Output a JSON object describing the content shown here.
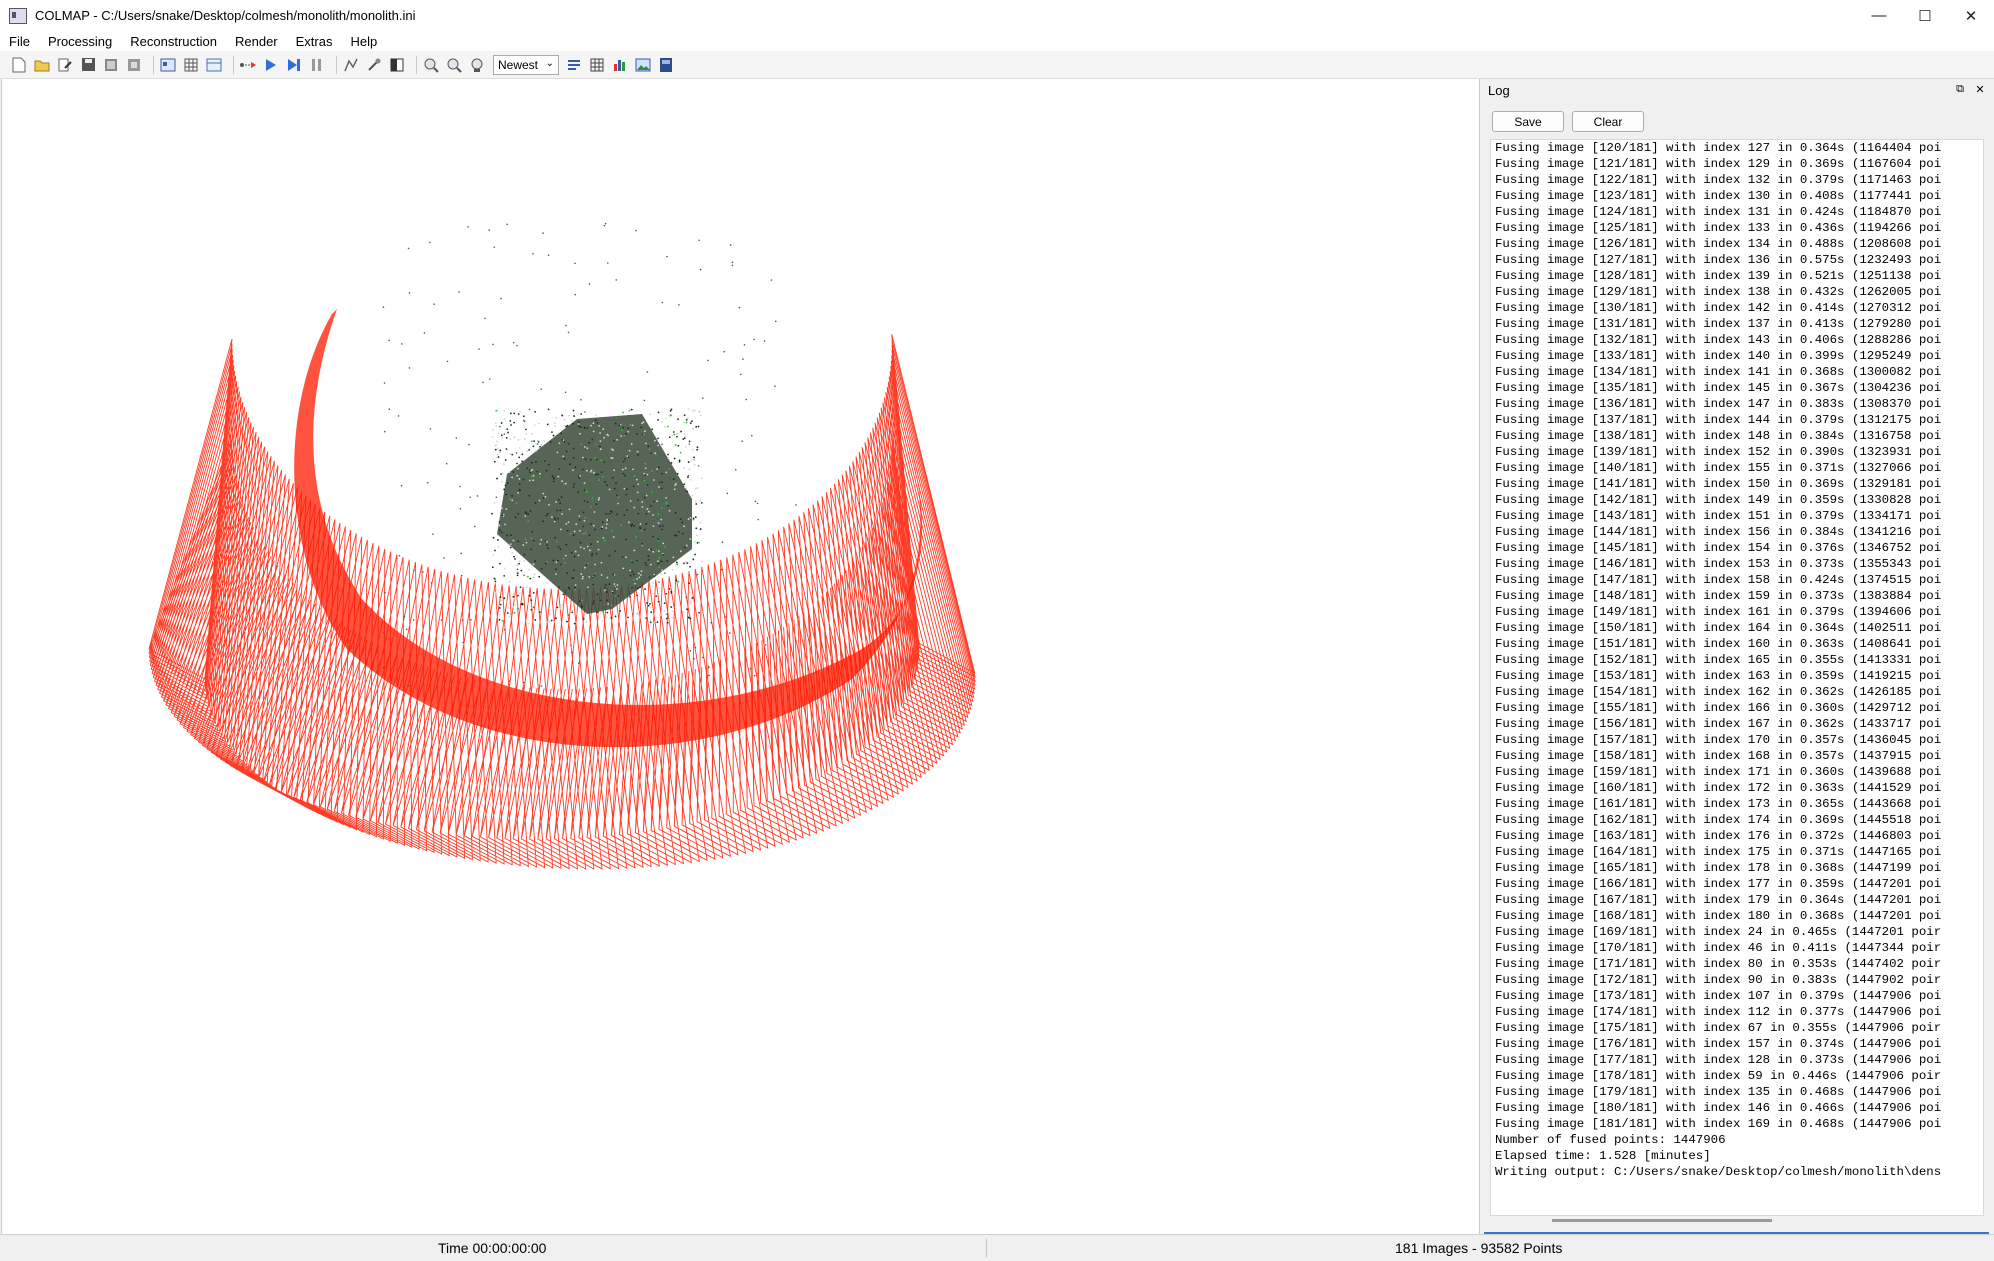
{
  "window": {
    "title": "COLMAP - C:/Users/snake/Desktop/colmesh/monolith/monolith.ini",
    "controls": [
      "—",
      "☐",
      "✕"
    ]
  },
  "menu": [
    "File",
    "Processing",
    "Reconstruction",
    "Render",
    "Extras",
    "Help"
  ],
  "toolbar": {
    "icons": [
      "new-project-icon",
      "open-project-icon",
      "edit-project-icon",
      "save-project-icon",
      "import-icon",
      "export-icon",
      "feature-extraction-icon",
      "feature-matching-icon",
      "database-icon",
      "automatic-reconstruction-icon",
      "start-reconstruction-icon",
      "step-reconstruction-icon",
      "pause-reconstruction-icon",
      "bundle-adjustment-icon",
      "dense-reconstruction-icon",
      "render-options-icon",
      "reconstruction-stats-icon",
      "match-matrix-icon",
      "log-icon"
    ],
    "reconstruction_select": "Newest"
  },
  "log": {
    "title": "Log",
    "save_label": "Save",
    "clear_label": "Clear",
    "lines": [
      "Fusing image [120/181] with index 127 in 0.364s (1164404 poi",
      "Fusing image [121/181] with index 129 in 0.369s (1167604 poi",
      "Fusing image [122/181] with index 132 in 0.379s (1171463 poi",
      "Fusing image [123/181] with index 130 in 0.408s (1177441 poi",
      "Fusing image [124/181] with index 131 in 0.424s (1184870 poi",
      "Fusing image [125/181] with index 133 in 0.436s (1194266 poi",
      "Fusing image [126/181] with index 134 in 0.488s (1208608 poi",
      "Fusing image [127/181] with index 136 in 0.575s (1232493 poi",
      "Fusing image [128/181] with index 139 in 0.521s (1251138 poi",
      "Fusing image [129/181] with index 138 in 0.432s (1262005 poi",
      "Fusing image [130/181] with index 142 in 0.414s (1270312 poi",
      "Fusing image [131/181] with index 137 in 0.413s (1279280 poi",
      "Fusing image [132/181] with index 143 in 0.406s (1288286 poi",
      "Fusing image [133/181] with index 140 in 0.399s (1295249 poi",
      "Fusing image [134/181] with index 141 in 0.368s (1300082 poi",
      "Fusing image [135/181] with index 145 in 0.367s (1304236 poi",
      "Fusing image [136/181] with index 147 in 0.383s (1308370 poi",
      "Fusing image [137/181] with index 144 in 0.379s (1312175 poi",
      "Fusing image [138/181] with index 148 in 0.384s (1316758 poi",
      "Fusing image [139/181] with index 152 in 0.390s (1323931 poi",
      "Fusing image [140/181] with index 155 in 0.371s (1327066 poi",
      "Fusing image [141/181] with index 150 in 0.369s (1329181 poi",
      "Fusing image [142/181] with index 149 in 0.359s (1330828 poi",
      "Fusing image [143/181] with index 151 in 0.379s (1334171 poi",
      "Fusing image [144/181] with index 156 in 0.384s (1341216 poi",
      "Fusing image [145/181] with index 154 in 0.376s (1346752 poi",
      "Fusing image [146/181] with index 153 in 0.373s (1355343 poi",
      "Fusing image [147/181] with index 158 in 0.424s (1374515 poi",
      "Fusing image [148/181] with index 159 in 0.373s (1383884 poi",
      "Fusing image [149/181] with index 161 in 0.379s (1394606 poi",
      "Fusing image [150/181] with index 164 in 0.364s (1402511 poi",
      "Fusing image [151/181] with index 160 in 0.363s (1408641 poi",
      "Fusing image [152/181] with index 165 in 0.355s (1413331 poi",
      "Fusing image [153/181] with index 163 in 0.359s (1419215 poi",
      "Fusing image [154/181] with index 162 in 0.362s (1426185 poi",
      "Fusing image [155/181] with index 166 in 0.360s (1429712 poi",
      "Fusing image [156/181] with index 167 in 0.362s (1433717 poi",
      "Fusing image [157/181] with index 170 in 0.357s (1436045 poi",
      "Fusing image [158/181] with index 168 in 0.357s (1437915 poi",
      "Fusing image [159/181] with index 171 in 0.360s (1439688 poi",
      "Fusing image [160/181] with index 172 in 0.363s (1441529 poi",
      "Fusing image [161/181] with index 173 in 0.365s (1443668 poi",
      "Fusing image [162/181] with index 174 in 0.369s (1445518 poi",
      "Fusing image [163/181] with index 176 in 0.372s (1446803 poi",
      "Fusing image [164/181] with index 175 in 0.371s (1447165 poi",
      "Fusing image [165/181] with index 178 in 0.368s (1447199 poi",
      "Fusing image [166/181] with index 177 in 0.359s (1447201 poi",
      "Fusing image [167/181] with index 179 in 0.364s (1447201 poi",
      "Fusing image [168/181] with index 180 in 0.368s (1447201 poi",
      "Fusing image [169/181] with index 24 in 0.465s (1447201 poir",
      "Fusing image [170/181] with index 46 in 0.411s (1447344 poir",
      "Fusing image [171/181] with index 80 in 0.353s (1447402 poir",
      "Fusing image [172/181] with index 90 in 0.383s (1447902 poir",
      "Fusing image [173/181] with index 107 in 0.379s (1447906 poi",
      "Fusing image [174/181] with index 112 in 0.377s (1447906 poi",
      "Fusing image [175/181] with index 67 in 0.355s (1447906 poir",
      "Fusing image [176/181] with index 157 in 0.374s (1447906 poi",
      "Fusing image [177/181] with index 128 in 0.373s (1447906 poi",
      "Fusing image [178/181] with index 59 in 0.446s (1447906 poir",
      "Fusing image [179/181] with index 135 in 0.468s (1447906 poi",
      "Fusing image [180/181] with index 146 in 0.466s (1447906 poi",
      "Fusing image [181/181] with index 169 in 0.468s (1447906 poi",
      "Number of fused points: 1447906",
      "Elapsed time: 1.528 [minutes]",
      "Writing output: C:/Users/snake/Desktop/colmesh/monolith\\dens"
    ]
  },
  "status": {
    "time": "Time 00:00:00:00",
    "counts": "181 Images - 93582 Points"
  },
  "colors": {
    "camera_frustum": "#ff1a00",
    "point_cloud_dark": "#3a4a3a",
    "point_cloud_accent": "#2fbf2f",
    "dock_accent": "#3b76c4"
  }
}
